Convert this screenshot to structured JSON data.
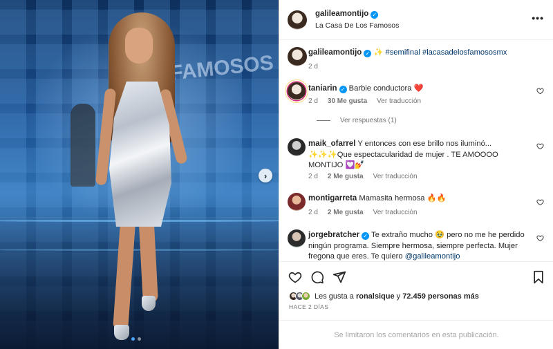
{
  "post": {
    "author": "galileamontijo",
    "location": "La Casa De Los Famosos",
    "more_label": "•••"
  },
  "caption": {
    "username": "galileamontijo",
    "sparkle": "✨",
    "hashtags": [
      "#semifinal",
      "#lacasadelosfamososmx"
    ],
    "time": "2 d"
  },
  "comments": [
    {
      "username": "taniarin",
      "verified": true,
      "text": "Barbie conductora ❤️",
      "time": "2 d",
      "likes": "30 Me gusta",
      "translate": "Ver traducción"
    },
    {
      "username": "maik_ofarrel",
      "verified": false,
      "text": "Y entonces con ese brillo nos iluminó... ✨✨✨Que espectacularidad de mujer . TE AMOOOO MONTIJO 💟💅",
      "time": "2 d",
      "likes": "2 Me gusta",
      "translate": "Ver traducción"
    },
    {
      "username": "montigarreta",
      "verified": false,
      "text": "Mamasita hermosa 🔥🔥",
      "time": "2 d",
      "likes": "2 Me gusta",
      "translate": "Ver traducción"
    },
    {
      "username": "jorgebratcher",
      "verified": true,
      "text": "Te extraño mucho 🥹 pero no me he perdido ningún programa. Siempre hermosa, siempre perfecta. Mujer fregona que eres. Te quiero",
      "mention": "@galileamontijo"
    }
  ],
  "view_replies": "Ver respuestas (1)",
  "likes_summary": {
    "prefix": "Les gusta a",
    "user": "ronalsique",
    "middle": "y",
    "count": "72.459 personas más"
  },
  "posted_ago": "HACE 2 DÍAS",
  "comments_limited": "Se limitaron los comentarios en esta publicación.",
  "media": {
    "sign_text": "de los\nFAMOSOS",
    "carousel": {
      "slides": 2,
      "active": 0
    },
    "accent": "#0095f6"
  }
}
